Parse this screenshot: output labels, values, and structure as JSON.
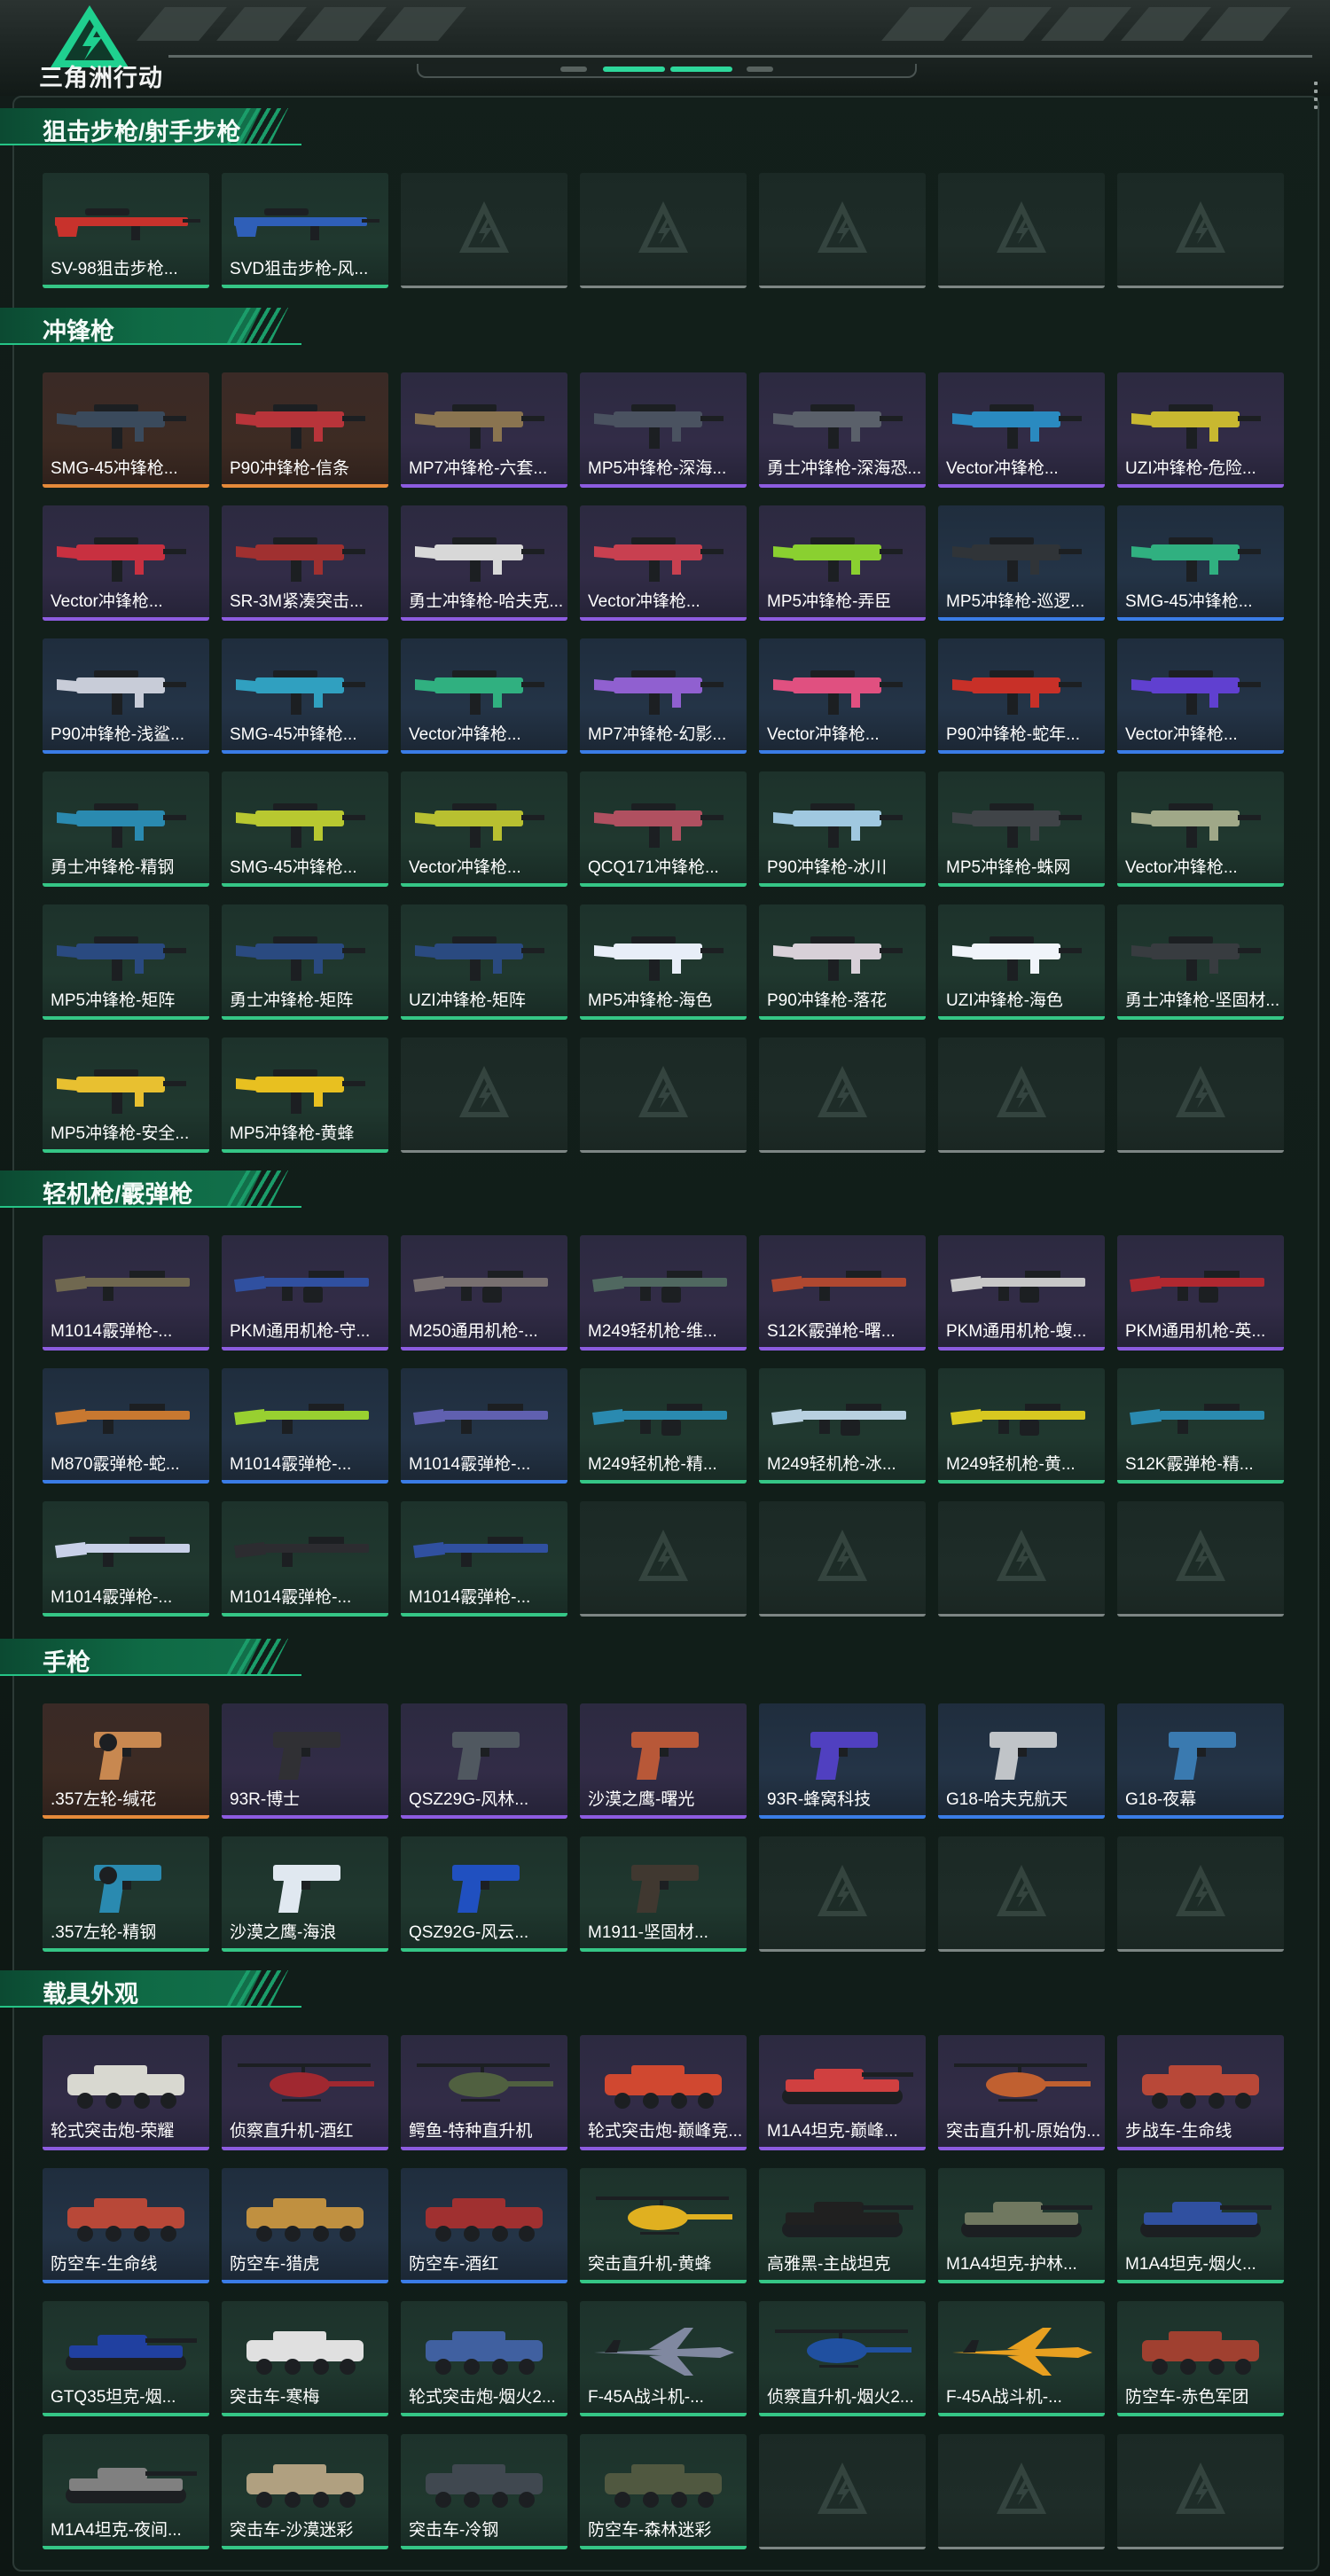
{
  "header": {
    "brand": "三角洲行动",
    "logo_icon": "delta-force-logo-icon",
    "active_page_indicator": 2
  },
  "colors": {
    "accent": "#2ed79b",
    "section": "#0f6a45",
    "rarity": {
      "orange": "#e68a3a",
      "purple": "#8d5ce0",
      "blue": "#3a7ce6",
      "green": "#35c686",
      "empty": "#7d8684"
    }
  },
  "sections": [
    {
      "title": "狙击步枪/射手步枪",
      "items": [
        {
          "label": "SV-98狙击步枪...",
          "rarity": "green",
          "icon": "sniper-rifle-icon",
          "color": "#c8322c"
        },
        {
          "label": "SVD狙击步枪-风...",
          "rarity": "green",
          "icon": "sniper-rifle-icon",
          "color": "#2f5fb8"
        },
        {
          "label": "",
          "rarity": "empty"
        },
        {
          "label": "",
          "rarity": "empty"
        },
        {
          "label": "",
          "rarity": "empty"
        },
        {
          "label": "",
          "rarity": "empty"
        },
        {
          "label": "",
          "rarity": "empty"
        }
      ]
    },
    {
      "title": "冲锋枪",
      "items": [
        {
          "label": "SMG-45冲锋枪...",
          "rarity": "orange",
          "icon": "smg-icon",
          "color": "#3a4a5c"
        },
        {
          "label": "P90冲锋枪-信条",
          "rarity": "orange",
          "icon": "smg-icon",
          "color": "#b8343a"
        },
        {
          "label": "MP7冲锋枪-六套...",
          "rarity": "purple",
          "icon": "smg-icon",
          "color": "#8a7450"
        },
        {
          "label": "MP5冲锋枪-深海...",
          "rarity": "purple",
          "icon": "smg-icon",
          "color": "#4a5260"
        },
        {
          "label": "勇士冲锋枪-深海恐...",
          "rarity": "purple",
          "icon": "smg-icon",
          "color": "#5a606a"
        },
        {
          "label": "Vector冲锋枪...",
          "rarity": "purple",
          "icon": "smg-icon",
          "color": "#2a8ac0"
        },
        {
          "label": "UZI冲锋枪-危险...",
          "rarity": "purple",
          "icon": "smg-icon",
          "color": "#c8b830"
        },
        {
          "label": "Vector冲锋枪...",
          "rarity": "purple",
          "icon": "smg-icon",
          "color": "#c83040"
        },
        {
          "label": "SR-3M紧凑突击...",
          "rarity": "purple",
          "icon": "smg-icon",
          "color": "#a03030"
        },
        {
          "label": "勇士冲锋枪-哈夫克...",
          "rarity": "purple",
          "icon": "smg-icon",
          "color": "#d8d8d8"
        },
        {
          "label": "Vector冲锋枪...",
          "rarity": "purple",
          "icon": "smg-icon",
          "color": "#c84050"
        },
        {
          "label": "MP5冲锋枪-弄臣",
          "rarity": "purple",
          "icon": "smg-icon",
          "color": "#8ad030"
        },
        {
          "label": "MP5冲锋枪-巡逻...",
          "rarity": "blue",
          "icon": "smg-icon",
          "color": "#303438"
        },
        {
          "label": "SMG-45冲锋枪...",
          "rarity": "blue",
          "icon": "smg-icon",
          "color": "#30b080"
        },
        {
          "label": "P90冲锋枪-浅鲨...",
          "rarity": "blue",
          "icon": "smg-icon",
          "color": "#c8ccd8"
        },
        {
          "label": "SMG-45冲锋枪...",
          "rarity": "blue",
          "icon": "smg-icon",
          "color": "#30a0c0"
        },
        {
          "label": "Vector冲锋枪...",
          "rarity": "blue",
          "icon": "smg-icon",
          "color": "#30b080"
        },
        {
          "label": "MP7冲锋枪-幻影...",
          "rarity": "blue",
          "icon": "smg-icon",
          "color": "#9060d0"
        },
        {
          "label": "Vector冲锋枪...",
          "rarity": "blue",
          "icon": "smg-icon",
          "color": "#e05080"
        },
        {
          "label": "P90冲锋枪-蛇年...",
          "rarity": "blue",
          "icon": "smg-icon",
          "color": "#c83028"
        },
        {
          "label": "Vector冲锋枪...",
          "rarity": "blue",
          "icon": "smg-icon",
          "color": "#6040d0"
        },
        {
          "label": "勇士冲锋枪-精钢",
          "rarity": "green",
          "icon": "smg-icon",
          "color": "#2a8ab0"
        },
        {
          "label": "SMG-45冲锋枪...",
          "rarity": "green",
          "icon": "smg-icon",
          "color": "#b8c830"
        },
        {
          "label": "Vector冲锋枪...",
          "rarity": "green",
          "icon": "smg-icon",
          "color": "#b8c030"
        },
        {
          "label": "QCQ171冲锋枪...",
          "rarity": "green",
          "icon": "smg-icon",
          "color": "#b05060"
        },
        {
          "label": "P90冲锋枪-冰川",
          "rarity": "green",
          "icon": "smg-icon",
          "color": "#a0c8e0"
        },
        {
          "label": "MP5冲锋枪-蛛网",
          "rarity": "green",
          "icon": "smg-icon",
          "color": "#404448"
        },
        {
          "label": "Vector冲锋枪...",
          "rarity": "green",
          "icon": "smg-icon",
          "color": "#a0a888"
        },
        {
          "label": "MP5冲锋枪-矩阵",
          "rarity": "green",
          "icon": "smg-icon",
          "color": "#2a4a80"
        },
        {
          "label": "勇士冲锋枪-矩阵",
          "rarity": "green",
          "icon": "smg-icon",
          "color": "#2a4a80"
        },
        {
          "label": "UZI冲锋枪-矩阵",
          "rarity": "green",
          "icon": "smg-icon",
          "color": "#2a4a80"
        },
        {
          "label": "MP5冲锋枪-海色",
          "rarity": "green",
          "icon": "smg-icon",
          "color": "#e8eef8"
        },
        {
          "label": "P90冲锋枪-落花",
          "rarity": "green",
          "icon": "smg-icon",
          "color": "#d8d0d8"
        },
        {
          "label": "UZI冲锋枪-海色",
          "rarity": "green",
          "icon": "smg-icon",
          "color": "#f0f4fa"
        },
        {
          "label": "勇士冲锋枪-坚固材...",
          "rarity": "green",
          "icon": "smg-icon",
          "color": "#383c40"
        },
        {
          "label": "MP5冲锋枪-安全...",
          "rarity": "green",
          "icon": "smg-icon",
          "color": "#e8c030"
        },
        {
          "label": "MP5冲锋枪-黄蜂",
          "rarity": "green",
          "icon": "smg-icon",
          "color": "#e8c020"
        },
        {
          "label": "",
          "rarity": "empty"
        },
        {
          "label": "",
          "rarity": "empty"
        },
        {
          "label": "",
          "rarity": "empty"
        },
        {
          "label": "",
          "rarity": "empty"
        },
        {
          "label": "",
          "rarity": "empty"
        }
      ]
    },
    {
      "title": "轻机枪/霰弹枪",
      "items": [
        {
          "label": "M1014霰弹枪-...",
          "rarity": "purple",
          "icon": "shotgun-icon",
          "color": "#706850"
        },
        {
          "label": "PKM通用机枪-守...",
          "rarity": "purple",
          "icon": "machine-gun-icon",
          "color": "#3050a0"
        },
        {
          "label": "M250通用机枪-...",
          "rarity": "purple",
          "icon": "machine-gun-icon",
          "color": "#787070"
        },
        {
          "label": "M249轻机枪-维...",
          "rarity": "purple",
          "icon": "machine-gun-icon",
          "color": "#506860"
        },
        {
          "label": "S12K霰弹枪-曙...",
          "rarity": "purple",
          "icon": "shotgun-icon",
          "color": "#b04830"
        },
        {
          "label": "PKM通用机枪-蝮...",
          "rarity": "purple",
          "icon": "machine-gun-icon",
          "color": "#c8c8c8"
        },
        {
          "label": "PKM通用机枪-英...",
          "rarity": "purple",
          "icon": "machine-gun-icon",
          "color": "#b02830"
        },
        {
          "label": "M870霰弹枪-蛇...",
          "rarity": "blue",
          "icon": "shotgun-icon",
          "color": "#c87830"
        },
        {
          "label": "M1014霰弹枪-...",
          "rarity": "blue",
          "icon": "shotgun-icon",
          "color": "#98d030"
        },
        {
          "label": "M1014霰弹枪-...",
          "rarity": "blue",
          "icon": "shotgun-icon",
          "color": "#6060b0"
        },
        {
          "label": "M249轻机枪-精...",
          "rarity": "green",
          "icon": "machine-gun-icon",
          "color": "#2a8ab0"
        },
        {
          "label": "M249轻机枪-冰...",
          "rarity": "green",
          "icon": "machine-gun-icon",
          "color": "#b8d0e0"
        },
        {
          "label": "M249轻机枪-黄...",
          "rarity": "green",
          "icon": "machine-gun-icon",
          "color": "#d8c820"
        },
        {
          "label": "S12K霰弹枪-精...",
          "rarity": "green",
          "icon": "shotgun-icon",
          "color": "#2a8ab0"
        },
        {
          "label": "M1014霰弹枪-...",
          "rarity": "green",
          "icon": "shotgun-icon",
          "color": "#c8d0e8"
        },
        {
          "label": "M1014霰弹枪-...",
          "rarity": "green",
          "icon": "shotgun-icon",
          "color": "#2c2c30"
        },
        {
          "label": "M1014霰弹枪-...",
          "rarity": "green",
          "icon": "shotgun-icon",
          "color": "#3050a0"
        },
        {
          "label": "",
          "rarity": "empty"
        },
        {
          "label": "",
          "rarity": "empty"
        },
        {
          "label": "",
          "rarity": "empty"
        },
        {
          "label": "",
          "rarity": "empty"
        }
      ]
    },
    {
      "title": "手枪",
      "items": [
        {
          "label": ".357左轮-缄花",
          "rarity": "orange",
          "icon": "revolver-icon",
          "color": "#c88850"
        },
        {
          "label": "93R-博士",
          "rarity": "purple",
          "icon": "pistol-icon",
          "color": "#303034"
        },
        {
          "label": "QSZ29G-风林...",
          "rarity": "purple",
          "icon": "pistol-icon",
          "color": "#505860"
        },
        {
          "label": "沙漠之鹰-曙光",
          "rarity": "purple",
          "icon": "pistol-icon",
          "color": "#b85838"
        },
        {
          "label": "93R-蜂窝科技",
          "rarity": "blue",
          "icon": "pistol-icon",
          "color": "#5040c0"
        },
        {
          "label": "G18-哈夫克航天",
          "rarity": "blue",
          "icon": "pistol-icon",
          "color": "#c0c4c8"
        },
        {
          "label": "G18-夜幕",
          "rarity": "blue",
          "icon": "pistol-icon",
          "color": "#3a7ab0"
        },
        {
          "label": ".357左轮-精钢",
          "rarity": "green",
          "icon": "revolver-icon",
          "color": "#2a8ab0"
        },
        {
          "label": "沙漠之鹰-海浪",
          "rarity": "green",
          "icon": "pistol-icon",
          "color": "#e0e8f0"
        },
        {
          "label": "QSZ92G-风云...",
          "rarity": "green",
          "icon": "pistol-icon",
          "color": "#2050c0"
        },
        {
          "label": "M1911-坚固材...",
          "rarity": "green",
          "icon": "pistol-icon",
          "color": "#403830"
        },
        {
          "label": "",
          "rarity": "empty"
        },
        {
          "label": "",
          "rarity": "empty"
        },
        {
          "label": "",
          "rarity": "empty"
        }
      ]
    },
    {
      "title": "载具外观",
      "items": [
        {
          "label": "轮式突击炮-荣耀",
          "rarity": "purple",
          "icon": "armored-vehicle-icon",
          "color": "#d8d8d0"
        },
        {
          "label": "侦察直升机-酒红",
          "rarity": "purple",
          "icon": "helicopter-icon",
          "color": "#a02830"
        },
        {
          "label": "鳄鱼-特种直升机",
          "rarity": "purple",
          "icon": "helicopter-icon",
          "color": "#506040"
        },
        {
          "label": "轮式突击炮-巅峰竞...",
          "rarity": "purple",
          "icon": "armored-vehicle-icon",
          "color": "#d04830"
        },
        {
          "label": "M1A4坦克-巅峰...",
          "rarity": "purple",
          "icon": "tank-icon",
          "color": "#d04040"
        },
        {
          "label": "突击直升机-原始伪...",
          "rarity": "purple",
          "icon": "helicopter-icon",
          "color": "#c06030"
        },
        {
          "label": "步战车-生命线",
          "rarity": "purple",
          "icon": "armored-vehicle-icon",
          "color": "#b84838"
        },
        {
          "label": "防空车-生命线",
          "rarity": "blue",
          "icon": "armored-vehicle-icon",
          "color": "#b84838"
        },
        {
          "label": "防空车-猎虎",
          "rarity": "blue",
          "icon": "armored-vehicle-icon",
          "color": "#c09040"
        },
        {
          "label": "防空车-酒红",
          "rarity": "blue",
          "icon": "armored-vehicle-icon",
          "color": "#a03030"
        },
        {
          "label": "突击直升机-黄蜂",
          "rarity": "green",
          "icon": "helicopter-icon",
          "color": "#e0b020"
        },
        {
          "label": "高雅黑-主战坦克",
          "rarity": "green",
          "icon": "tank-icon",
          "color": "#202020"
        },
        {
          "label": "M1A4坦克-护林...",
          "rarity": "green",
          "icon": "tank-icon",
          "color": "#707860"
        },
        {
          "label": "M1A4坦克-烟火...",
          "rarity": "green",
          "icon": "tank-icon",
          "color": "#3050a0"
        },
        {
          "label": "GTQ35坦克-烟...",
          "rarity": "green",
          "icon": "tank-icon",
          "color": "#2040a0"
        },
        {
          "label": "突击车-寒梅",
          "rarity": "green",
          "icon": "armored-vehicle-icon",
          "color": "#e0e0e0"
        },
        {
          "label": "轮式突击炮-烟火2...",
          "rarity": "green",
          "icon": "armored-vehicle-icon",
          "color": "#4060a0"
        },
        {
          "label": "F-45A战斗机-...",
          "rarity": "green",
          "icon": "jet-icon",
          "color": "#8088a0"
        },
        {
          "label": "侦察直升机-烟火2...",
          "rarity": "green",
          "icon": "helicopter-icon",
          "color": "#2050a0"
        },
        {
          "label": "F-45A战斗机-...",
          "rarity": "green",
          "icon": "jet-icon",
          "color": "#e8a020"
        },
        {
          "label": "防空车-赤色军团",
          "rarity": "green",
          "icon": "armored-vehicle-icon",
          "color": "#a04030"
        },
        {
          "label": "M1A4坦克-夜间...",
          "rarity": "green",
          "icon": "tank-icon",
          "color": "#808080"
        },
        {
          "label": "突击车-沙漠迷彩",
          "rarity": "green",
          "icon": "armored-vehicle-icon",
          "color": "#b0a080"
        },
        {
          "label": "突击车-冷钢",
          "rarity": "green",
          "icon": "armored-vehicle-icon",
          "color": "#404850"
        },
        {
          "label": "防空车-森林迷彩",
          "rarity": "green",
          "icon": "armored-vehicle-icon",
          "color": "#505840"
        },
        {
          "label": "",
          "rarity": "empty"
        },
        {
          "label": "",
          "rarity": "empty"
        },
        {
          "label": "",
          "rarity": "empty"
        }
      ]
    }
  ]
}
